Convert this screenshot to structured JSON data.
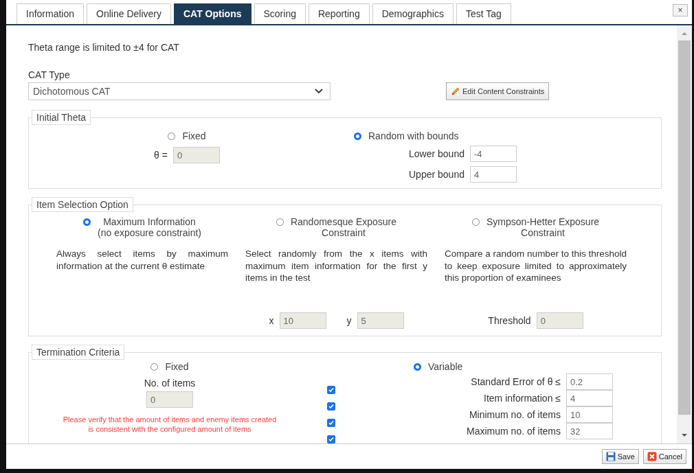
{
  "tabs": [
    {
      "label": "Information",
      "selected": false
    },
    {
      "label": "Online Delivery",
      "selected": false
    },
    {
      "label": "CAT Options",
      "selected": true
    },
    {
      "label": "Scoring",
      "selected": false
    },
    {
      "label": "Reporting",
      "selected": false
    },
    {
      "label": "Demographics",
      "selected": false
    },
    {
      "label": "Test Tag",
      "selected": false
    }
  ],
  "close_button": "×",
  "notice": "Theta range is limited to ±4 for CAT",
  "cat_type": {
    "label": "CAT Type",
    "value": "Dichotomous CAT"
  },
  "edit_constraints_button": "Edit Content Constraints",
  "initial_theta": {
    "legend": "Initial Theta",
    "fixed": {
      "label": "Fixed",
      "selected": false
    },
    "theta": {
      "label": "θ =",
      "value": "0",
      "disabled": true
    },
    "random": {
      "label": "Random with bounds",
      "selected": true
    },
    "bounds": [
      {
        "label": "Lower bound",
        "value": "-4",
        "disabled": false
      },
      {
        "label": "Upper bound",
        "value": "4",
        "disabled": false
      }
    ]
  },
  "item_selection": {
    "legend": "Item Selection Option",
    "options": [
      {
        "label": "Maximum Information\n(no exposure constraint)",
        "selected": true,
        "description": "Always select items by maximum information at the current θ estimate"
      },
      {
        "label": "Randomesque Exposure\nConstraint",
        "selected": false,
        "description": "Select randomly from the x items with maximum item information for the first y items in the test",
        "inputs": [
          {
            "label": "x",
            "value": "10",
            "disabled": true
          },
          {
            "label": "y",
            "value": "5",
            "disabled": true
          }
        ]
      },
      {
        "label": "Sympson-Hetter Exposure\nConstraint",
        "selected": false,
        "description": "Compare a random number to this threshold to keep exposure limited to approximately this proportion of examinees",
        "inputs": [
          {
            "label": "Threshold",
            "value": "0",
            "disabled": true
          }
        ]
      }
    ]
  },
  "termination": {
    "legend": "Termination Criteria",
    "fixed": {
      "label": "Fixed",
      "selected": false
    },
    "items": {
      "label": "No. of items",
      "value": "0",
      "disabled": true
    },
    "warning": "Please verify that the amount of items and enemy items created is consistent with the configured amount of items",
    "variable": {
      "label": "Variable",
      "selected": true
    },
    "criteria": [
      {
        "label": "Standard Error of θ ≤",
        "value": "0.2",
        "checked": true,
        "disabled": false
      },
      {
        "label": "Item information ≤",
        "value": "4",
        "checked": true,
        "disabled": false
      },
      {
        "label": "Minimum no. of items",
        "value": "10",
        "checked": true,
        "disabled": false
      },
      {
        "label": "Maximum no. of items",
        "value": "32",
        "checked": true,
        "disabled": false
      }
    ]
  },
  "footer_buttons": [
    {
      "label": "Save",
      "kind": "save"
    },
    {
      "label": "Cancel",
      "kind": "cancel"
    }
  ]
}
